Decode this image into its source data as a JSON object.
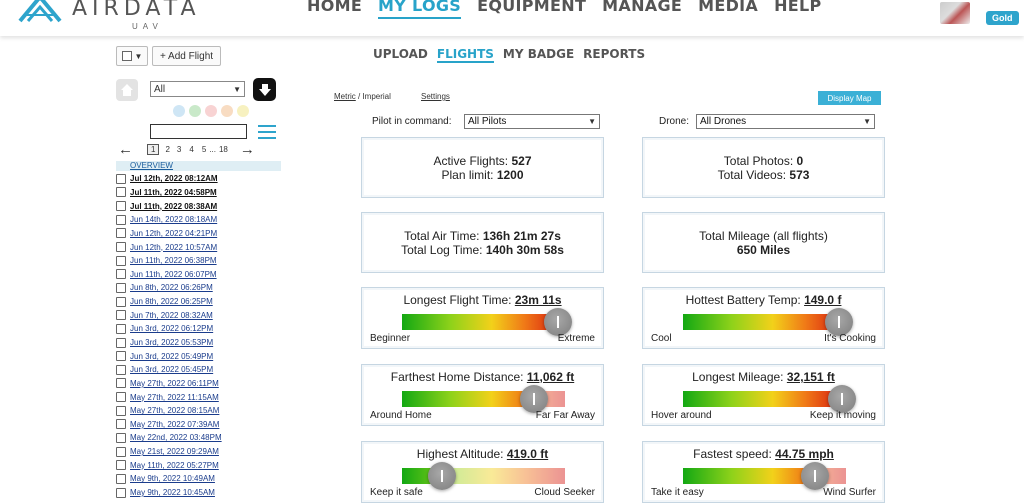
{
  "brand": {
    "name": "AIRDATA",
    "sub": "UAV",
    "color": "#2ea4cc"
  },
  "nav": {
    "items": [
      {
        "label": "HOME",
        "active": false
      },
      {
        "label": "MY LOGS",
        "active": true
      },
      {
        "label": "EQUIPMENT",
        "active": false
      },
      {
        "label": "MANAGE",
        "active": false
      },
      {
        "label": "MEDIA",
        "active": false
      },
      {
        "label": "HELP",
        "active": false
      }
    ],
    "badge": "Gold"
  },
  "subnav": {
    "items": [
      {
        "label": "UPLOAD",
        "active": false
      },
      {
        "label": "FLIGHTS",
        "active": true
      },
      {
        "label": "MY BADGE",
        "active": false
      },
      {
        "label": "REPORTS",
        "active": false
      }
    ]
  },
  "left": {
    "add_flight": "+ Add Flight",
    "filter_value": "All",
    "color_dots": [
      "#cfe6f5",
      "#c9e9c9",
      "#f8d3d3",
      "#f8dcc2",
      "#f7f1c0"
    ],
    "pager": {
      "pages": [
        "1",
        "2",
        "3",
        "4",
        "5",
        "...",
        "18"
      ],
      "current": "1"
    },
    "overview": "OVERVIEW",
    "flights": [
      {
        "label": "Jul 12th, 2022 08:12AM",
        "bold": true
      },
      {
        "label": "Jul 11th, 2022 04:58PM",
        "bold": true
      },
      {
        "label": "Jul 11th, 2022 08:38AM",
        "bold": true
      },
      {
        "label": "Jun 14th, 2022 08:18AM",
        "bold": false
      },
      {
        "label": "Jun 12th, 2022 04:21PM",
        "bold": false
      },
      {
        "label": "Jun 12th, 2022 10:57AM",
        "bold": false
      },
      {
        "label": "Jun 11th, 2022 06:38PM",
        "bold": false
      },
      {
        "label": "Jun 11th, 2022 06:07PM",
        "bold": false
      },
      {
        "label": "Jun 8th, 2022 06:26PM",
        "bold": false
      },
      {
        "label": "Jun 8th, 2022 06:25PM",
        "bold": false
      },
      {
        "label": "Jun 7th, 2022 08:32AM",
        "bold": false
      },
      {
        "label": "Jun 3rd, 2022 06:12PM",
        "bold": false
      },
      {
        "label": "Jun 3rd, 2022 05:53PM",
        "bold": false
      },
      {
        "label": "Jun 3rd, 2022 05:49PM",
        "bold": false
      },
      {
        "label": "Jun 3rd, 2022 05:45PM",
        "bold": false
      },
      {
        "label": "May 27th, 2022 06:11PM",
        "bold": false
      },
      {
        "label": "May 27th, 2022 11:15AM",
        "bold": false
      },
      {
        "label": "May 27th, 2022 08:15AM",
        "bold": false
      },
      {
        "label": "May 27th, 2022 07:39AM",
        "bold": false
      },
      {
        "label": "May 22nd, 2022 03:48PM",
        "bold": false
      },
      {
        "label": "May 21st, 2022 09:29AM",
        "bold": false
      },
      {
        "label": "May 11th, 2022 05:27PM",
        "bold": false
      },
      {
        "label": "May 9th, 2022 10:49AM",
        "bold": false
      },
      {
        "label": "May 9th, 2022 10:45AM",
        "bold": false
      }
    ]
  },
  "options": {
    "metric": "Metric",
    "separator": " / ",
    "imperial": "Imperial",
    "settings": "Settings",
    "display_map": "Display Map",
    "pilot_label": "Pilot in command:",
    "pilot_value": "All Pilots",
    "drone_label": "Drone:",
    "drone_value": "All Drones"
  },
  "stats": {
    "active_flights_label": "Active Flights:",
    "active_flights": "527",
    "plan_limit_label": "Plan limit:",
    "plan_limit": "1200",
    "total_photos_label": "Total Photos:",
    "total_photos": "0",
    "total_videos_label": "Total Videos:",
    "total_videos": "573",
    "air_time_label": "Total Air Time:",
    "air_time": "136h 21m 27s",
    "log_time_label": "Total Log Time:",
    "log_time": "140h 30m 58s",
    "mileage_label": "Total Mileage (all flights)",
    "mileage": "650 Miles"
  },
  "gauges": [
    {
      "title": "Longest Flight Time:",
      "value": "23m 11s",
      "left": "Beginner",
      "right": "Extreme",
      "level": 0.98
    },
    {
      "title": "Hottest Battery Temp:",
      "value": "149.0 f",
      "left": "Cool",
      "right": "It's Cooking",
      "level": 0.98
    },
    {
      "title": "Farthest Home Distance:",
      "value": "11,062 ft",
      "left": "Around Home",
      "right": "Far Far Away",
      "level": 0.82
    },
    {
      "title": "Longest Mileage:",
      "value": "32,151 ft",
      "left": "Hover around",
      "right": "Keep it moving",
      "level": 1.0
    },
    {
      "title": "Highest Altitude:",
      "value": "419.0 ft",
      "left": "Keep it safe",
      "right": "Cloud Seeker",
      "level": 0.2
    },
    {
      "title": "Fastest speed:",
      "value": "44.75 mph",
      "left": "Take it easy",
      "right": "Wind Surfer",
      "level": 0.82
    }
  ]
}
